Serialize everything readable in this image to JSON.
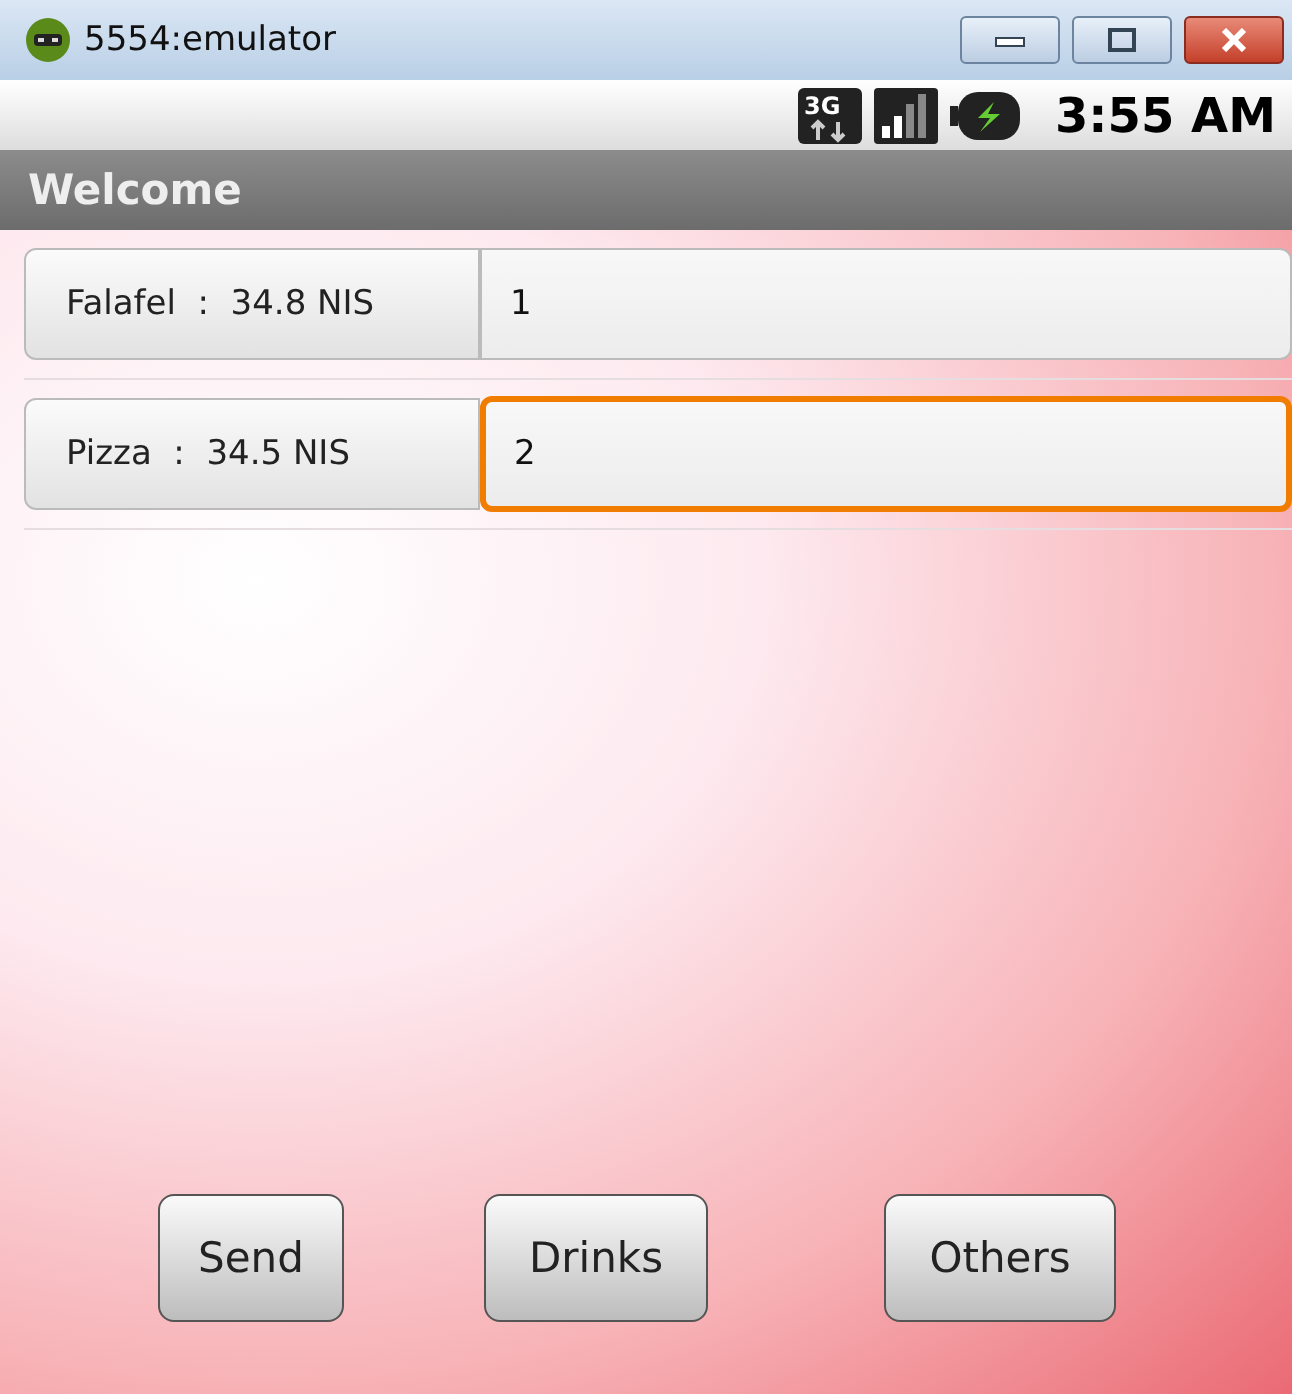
{
  "window": {
    "title": "5554:emulator"
  },
  "status_bar": {
    "network": "3G",
    "time": "3:55 AM"
  },
  "app_title": "Welcome",
  "items": [
    {
      "label": "Falafel  :  34.8 NIS",
      "value": "1",
      "focused": false
    },
    {
      "label": "Pizza  :  34.5 NIS",
      "value": "2",
      "focused": true
    }
  ],
  "buttons": [
    "Send",
    "Drinks",
    "Others"
  ]
}
